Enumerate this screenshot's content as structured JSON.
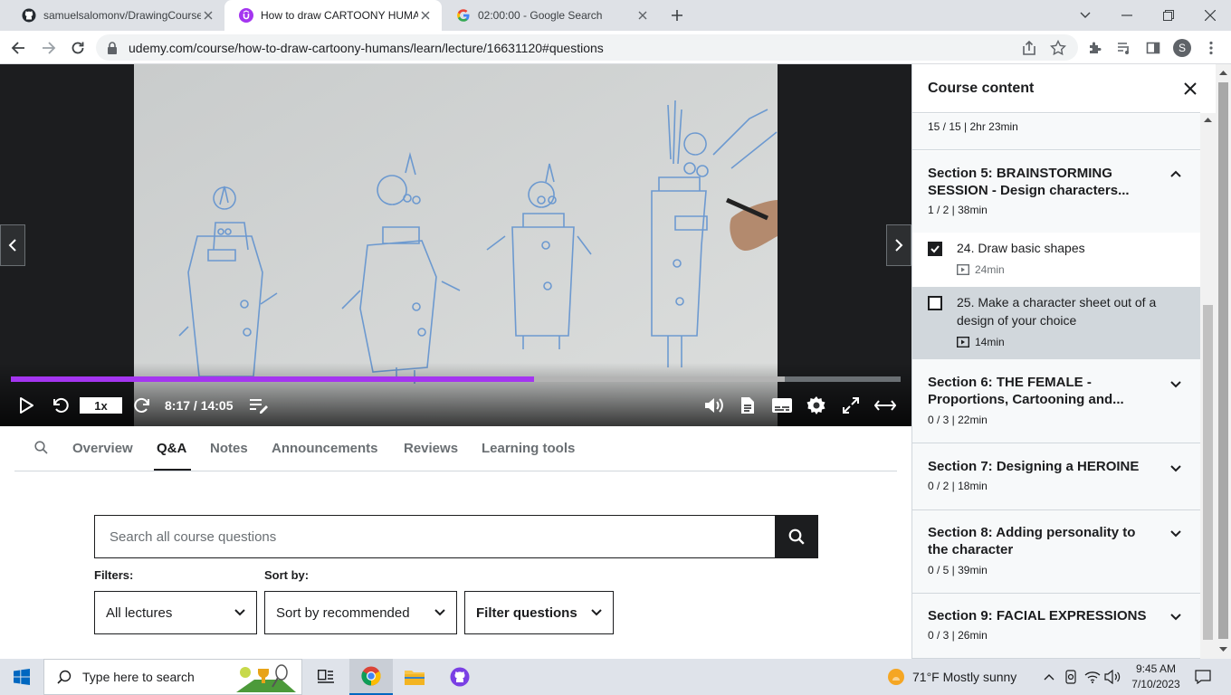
{
  "browser": {
    "tabs": [
      {
        "title": "samuelsalomonv/DrawingCourse",
        "icon": "github-icon",
        "active": false
      },
      {
        "title": "How to draw CARTOONY HUMAN",
        "icon": "udemy-icon",
        "active": true
      },
      {
        "title": "02:00:00 - Google Search",
        "icon": "google-icon",
        "active": false
      }
    ],
    "url": "udemy.com/course/how-to-draw-cartoony-humans/learn/lecture/16631120#questions",
    "profile_initial": "S"
  },
  "player": {
    "progress_fraction": 0.588,
    "buffered_fraction": 0.87,
    "rate": "1x",
    "time": "8:17 / 14:05"
  },
  "course_tabs": [
    "Overview",
    "Q&A",
    "Notes",
    "Announcements",
    "Reviews",
    "Learning tools"
  ],
  "active_course_tab": "Q&A",
  "qa": {
    "search_placeholder": "Search all course questions",
    "filters_label": "Filters:",
    "sort_label": "Sort by:",
    "lectures_select": "All lectures",
    "sort_select": "Sort by recommended",
    "filter_button": "Filter questions"
  },
  "sidebar": {
    "title": "Course content",
    "prev_section_meta": "15 / 15 | 2hr 23min",
    "sections": [
      {
        "title": "Section 5: BRAINSTORMING SESSION - Design characters...",
        "meta": "1 / 2 | 38min",
        "expanded": true,
        "lectures": [
          {
            "title": "24. Draw basic shapes",
            "duration": "24min",
            "done": true
          },
          {
            "title": "25. Make a character sheet out of a design of your choice",
            "duration": "14min",
            "done": false,
            "current": true
          }
        ]
      },
      {
        "title": "Section 6: THE FEMALE - Proportions, Cartooning and...",
        "meta": "0 / 3 | 22min",
        "expanded": false
      },
      {
        "title": "Section 7: Designing a HEROINE",
        "meta": "0 / 2 | 18min",
        "expanded": false
      },
      {
        "title": "Section 8: Adding personality to the character",
        "meta": "0 / 5 | 39min",
        "expanded": false
      },
      {
        "title": "Section 9: FACIAL EXPRESSIONS",
        "meta": "0 / 3 | 26min",
        "expanded": false
      }
    ]
  },
  "taskbar": {
    "search_text": "Type here to search",
    "weather": "71°F  Mostly sunny",
    "time": "9:45 AM",
    "date": "7/10/2023"
  },
  "colors": {
    "accent": "#a435f0",
    "dark": "#1c1d1f",
    "sidebar_section_bg": "#f7f9fa",
    "current_lecture_bg": "#d1d7dc"
  }
}
